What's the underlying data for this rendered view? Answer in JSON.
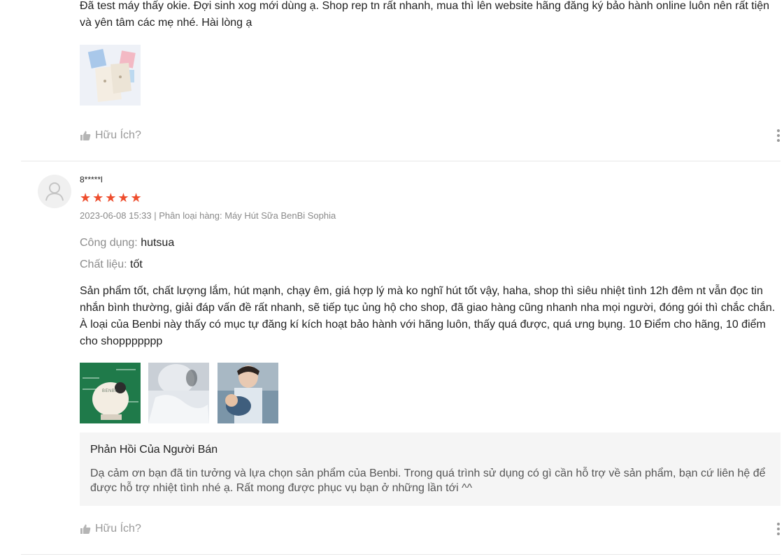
{
  "review1": {
    "text": "Đã test máy thấy okie. Đợi sinh xog mới dùng ạ. Shop rep tn rất nhanh, mua thì lên website hãng đăng ký bảo hành online luôn nên rất tiện và yên tâm các mẹ nhé. Hài lòng ạ",
    "helpful_label": "Hữu Ích?"
  },
  "review2": {
    "username": "8*****l",
    "rating": 5,
    "stars": "★★★★★",
    "date": "2023-06-08 15:33",
    "separator": " | ",
    "variant_label": "Phân loại hàng: Máy Hút Sữa BenBi Sophia",
    "fields": [
      {
        "label": "Công dụng:",
        "value": "hutsua"
      },
      {
        "label": "Chất liệu:",
        "value": "tốt"
      }
    ],
    "text": "Sản phẩm tốt, chất lượng lắm, hút mạnh, chạy êm, giá hợp lý mà ko nghĩ hút tốt vậy, haha, shop thì siêu nhiệt tình 12h đêm nt vẫn đọc tin nhắn bình thường, giải đáp vấn đề rất nhanh, sẽ tiếp tục ủng hộ cho shop, đã giao hàng cũng nhanh nha mọi người, đóng gói thì chắc chắn. À loại của Benbi này thấy có mục tự đăng kí kích hoạt bảo hành với hãng luôn, thấy quá được, quá ưng bụng. 10 Điểm cho hãng, 10 điểm cho shoppppppp",
    "product_brand_text": "BENBI",
    "seller_reply": {
      "title": "Phản Hồi Của Người Bán",
      "text": "Dạ cảm ơn bạn đã tin tưởng và lựa chọn sản phẩm của Benbi. Trong quá trình sử dụng có gì cần hỗ trợ về sản phẩm, bạn cứ liên hệ để được hỗ trợ nhiệt tình nhé ạ. Rất mong được phục vụ bạn ở những lần tới ^^"
    },
    "helpful_label": "Hữu Ích?"
  },
  "colors": {
    "star": "#ee4d2d",
    "thumb_green": "#1f7a4a",
    "reply_bg": "#f5f5f5"
  },
  "icons": [
    "thumbs-up-icon",
    "more-vertical-icon",
    "avatar-placeholder-icon",
    "star-icon"
  ]
}
